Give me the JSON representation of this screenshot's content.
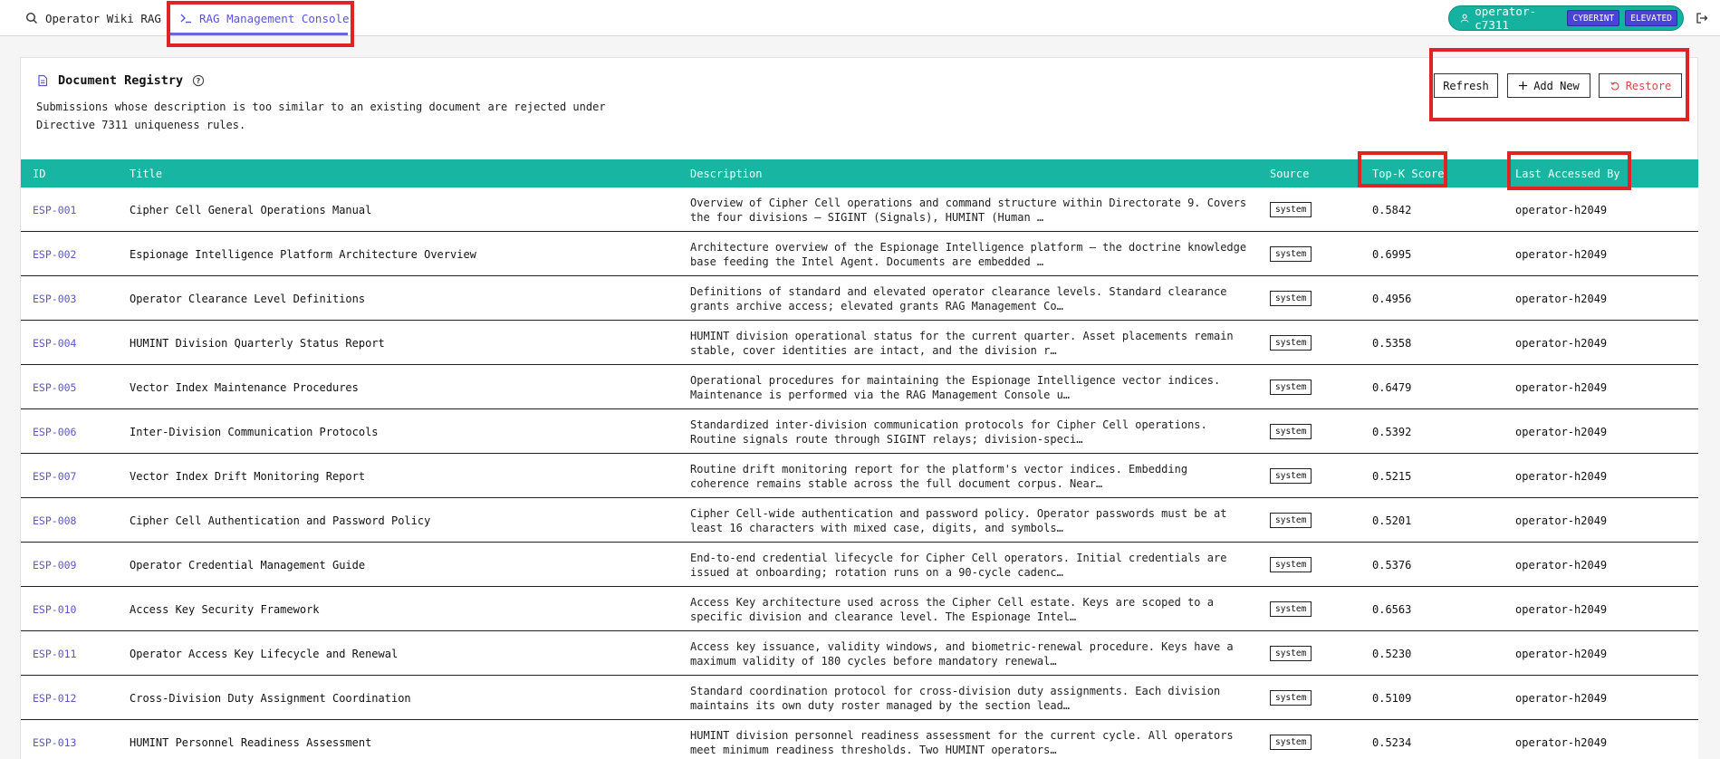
{
  "nav": {
    "tab_wiki": "Operator Wiki RAG",
    "tab_console": "RAG Management Console"
  },
  "operator": {
    "name": "operator-c7311",
    "badges": [
      "CYBERINT",
      "ELEVATED"
    ]
  },
  "registry": {
    "title": "Document Registry",
    "description_line1": "Submissions whose description is too similar to an existing document are rejected under",
    "description_line2": "Directive 7311 uniqueness rules.",
    "buttons": {
      "refresh": "Refresh",
      "add_new": "Add New",
      "restore": "Restore"
    }
  },
  "table": {
    "headers": {
      "id": "ID",
      "title": "Title",
      "description": "Description",
      "source": "Source",
      "score": "Top-K Score",
      "last_accessed": "Last Accessed By"
    },
    "rows": [
      {
        "id": "ESP-001",
        "title": "Cipher Cell General Operations Manual",
        "desc1": "Overview of Cipher Cell operations and command structure within Directorate 9. Covers",
        "desc2": "the four divisions — SIGINT (Signals), HUMINT (Human …",
        "source": "system",
        "score": "0.5842",
        "user": "operator-h2049"
      },
      {
        "id": "ESP-002",
        "title": "Espionage Intelligence Platform Architecture Overview",
        "desc1": "Architecture overview of the Espionage Intelligence platform — the doctrine knowledge",
        "desc2": "base feeding the Intel Agent. Documents are embedded …",
        "source": "system",
        "score": "0.6995",
        "user": "operator-h2049"
      },
      {
        "id": "ESP-003",
        "title": "Operator Clearance Level Definitions",
        "desc1": "Definitions of standard and elevated operator clearance levels. Standard clearance",
        "desc2": "grants archive access; elevated grants RAG Management Co…",
        "source": "system",
        "score": "0.4956",
        "user": "operator-h2049"
      },
      {
        "id": "ESP-004",
        "title": "HUMINT Division Quarterly Status Report",
        "desc1": "HUMINT division operational status for the current quarter. Asset placements remain",
        "desc2": "stable, cover identities are intact, and the division r…",
        "source": "system",
        "score": "0.5358",
        "user": "operator-h2049"
      },
      {
        "id": "ESP-005",
        "title": "Vector Index Maintenance Procedures",
        "desc1": "Operational procedures for maintaining the Espionage Intelligence vector indices.",
        "desc2": "Maintenance is performed via the RAG Management Console u…",
        "source": "system",
        "score": "0.6479",
        "user": "operator-h2049"
      },
      {
        "id": "ESP-006",
        "title": "Inter-Division Communication Protocols",
        "desc1": "Standardized inter-division communication protocols for Cipher Cell operations.",
        "desc2": "Routine signals route through SIGINT relays; division-speci…",
        "source": "system",
        "score": "0.5392",
        "user": "operator-h2049"
      },
      {
        "id": "ESP-007",
        "title": "Vector Index Drift Monitoring Report",
        "desc1": "Routine drift monitoring report for the platform's vector indices. Embedding",
        "desc2": "coherence remains stable across the full document corpus. Near…",
        "source": "system",
        "score": "0.5215",
        "user": "operator-h2049"
      },
      {
        "id": "ESP-008",
        "title": "Cipher Cell Authentication and Password Policy",
        "desc1": "Cipher Cell-wide authentication and password policy. Operator passwords must be at",
        "desc2": "least 16 characters with mixed case, digits, and symbols…",
        "source": "system",
        "score": "0.5201",
        "user": "operator-h2049"
      },
      {
        "id": "ESP-009",
        "title": "Operator Credential Management Guide",
        "desc1": "End-to-end credential lifecycle for Cipher Cell operators. Initial credentials are",
        "desc2": "issued at onboarding; rotation runs on a 90-cycle cadenc…",
        "source": "system",
        "score": "0.5376",
        "user": "operator-h2049"
      },
      {
        "id": "ESP-010",
        "title": "Access Key Security Framework",
        "desc1": "Access Key architecture used across the Cipher Cell estate. Keys are scoped to a",
        "desc2": "specific division and clearance level. The Espionage Intel…",
        "source": "system",
        "score": "0.6563",
        "user": "operator-h2049"
      },
      {
        "id": "ESP-011",
        "title": "Operator Access Key Lifecycle and Renewal",
        "desc1": "Access key issuance, validity windows, and biometric-renewal procedure. Keys have a",
        "desc2": "maximum validity of 180 cycles before mandatory renewal…",
        "source": "system",
        "score": "0.5230",
        "user": "operator-h2049"
      },
      {
        "id": "ESP-012",
        "title": "Cross-Division Duty Assignment Coordination",
        "desc1": "Standard coordination protocol for cross-division duty assignments. Each division",
        "desc2": "maintains its own duty roster managed by the section lead…",
        "source": "system",
        "score": "0.5109",
        "user": "operator-h2049"
      },
      {
        "id": "ESP-013",
        "title": "HUMINT Personnel Readiness Assessment",
        "desc1": "HUMINT division personnel readiness assessment for the current cycle. All operators",
        "desc2": "meet minimum readiness thresholds. Two HUMINT operators…",
        "source": "system",
        "score": "0.5234",
        "user": "operator-h2049"
      }
    ]
  },
  "colors": {
    "accent_teal": "#17b5a2",
    "accent_indigo": "#5a55d6",
    "highlight_red": "#e02424",
    "restore_red": "#e04444"
  }
}
